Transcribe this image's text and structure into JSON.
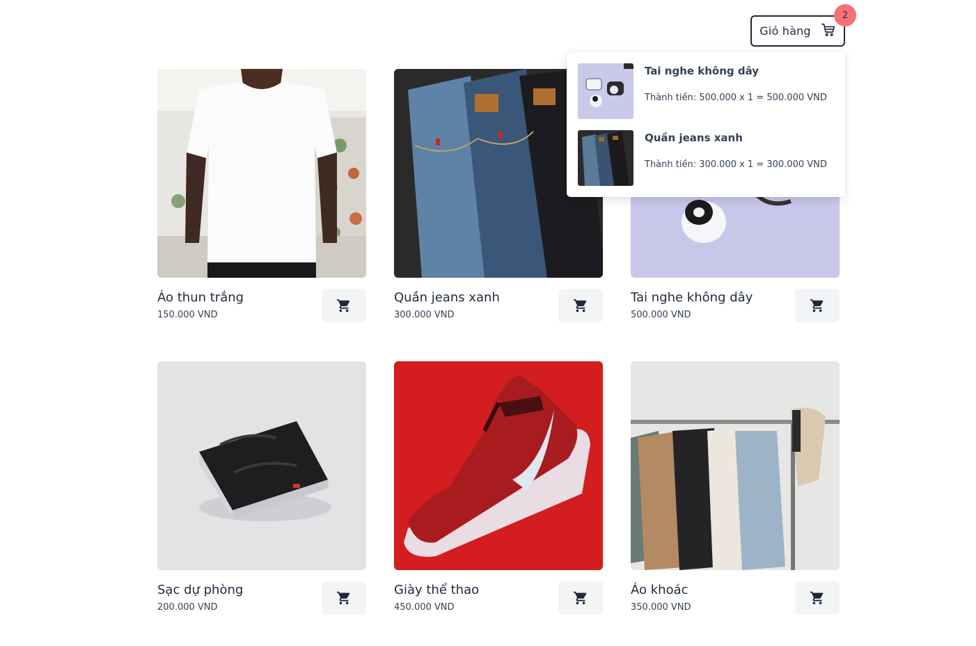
{
  "header": {
    "cart_label": "Giỏ hàng",
    "cart_count": "2"
  },
  "cart_dropdown": {
    "items": [
      {
        "name": "Tai nghe không dây",
        "total": "Thành tiền: 500.000 x 1 = 500.000 VND",
        "thumb_icon": "earbuds-photo"
      },
      {
        "name": "Quần jeans xanh",
        "total": "Thành tiền: 300.000 x 1 = 300.000 VND",
        "thumb_icon": "jeans-photo"
      }
    ]
  },
  "products": [
    {
      "name": "Áo thun trắng",
      "price": "150.000 VND",
      "image_icon": "white-tshirt-photo"
    },
    {
      "name": "Quần jeans xanh",
      "price": "300.000 VND",
      "image_icon": "jeans-photo"
    },
    {
      "name": "Tai nghe không dây",
      "price": "500.000 VND",
      "image_icon": "earbuds-photo"
    },
    {
      "name": "Sạc dự phòng",
      "price": "200.000 VND",
      "image_icon": "power-bank-photo"
    },
    {
      "name": "Giày thể thao",
      "price": "450.000 VND",
      "image_icon": "sneaker-photo"
    },
    {
      "name": "Áo khoác",
      "price": "350.000 VND",
      "image_icon": "jackets-rack-photo"
    }
  ],
  "colors": {
    "text": "#1e293b",
    "badge": "#f87171",
    "button_bg": "#f3f4f6"
  }
}
